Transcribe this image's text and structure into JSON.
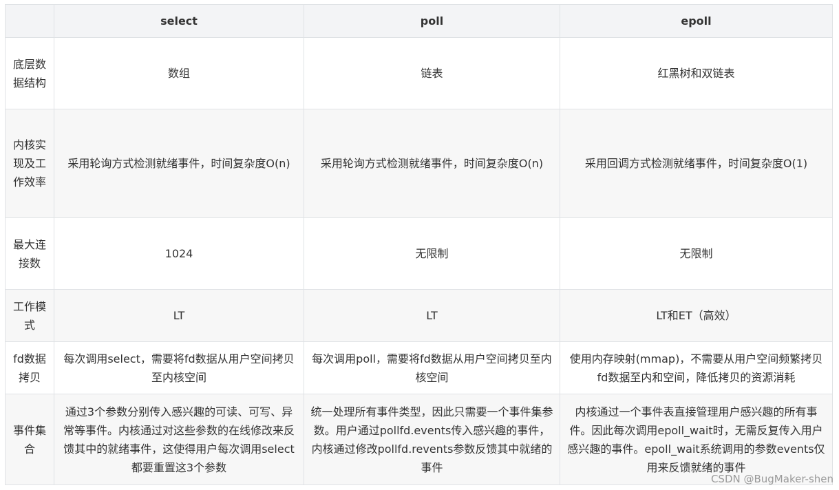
{
  "table": {
    "headers": [
      "",
      "select",
      "poll",
      "epoll"
    ],
    "rows": [
      {
        "label": "底层数据结构",
        "select": "数组",
        "poll": "链表",
        "epoll": "红黑树和双链表"
      },
      {
        "label": "内核实现及工作效率",
        "select": "采用轮询方式检测就绪事件，时间复杂度O(n)",
        "poll": "采用轮询方式检测就绪事件，时间复杂度O(n)",
        "epoll": "采用回调方式检测就绪事件，时间复杂度O(1)"
      },
      {
        "label": "最大连接数",
        "select": "1024",
        "poll": "无限制",
        "epoll": "无限制"
      },
      {
        "label": "工作模式",
        "select": "LT",
        "poll": "LT",
        "epoll": "LT和ET（高效）"
      },
      {
        "label": "fd数据拷贝",
        "select": "每次调用select，需要将fd数据从用户空间拷贝至内核空间",
        "poll": "每次调用poll，需要将fd数据从用户空间拷贝至内核空间",
        "epoll": "使用内存映射(mmap)，不需要从用户空间频繁拷贝fd数据至内和空间，降低拷贝的资源消耗"
      },
      {
        "label": "事件集合",
        "select": "通过3个参数分别传入感兴趣的可读、可写、异常等事件。内核通过对这些参数的在线修改来反馈其中的就绪事件，这使得用户每次调用select都要重置这3个参数",
        "poll": "统一处理所有事件类型，因此只需要一个事件集参数。用户通过pollfd.events传入感兴趣的事件，内核通过修改pollfd.revents参数反馈其中就绪的事件",
        "epoll": "内核通过一个事件表直接管理用户感兴趣的所有事件。因此每次调用epoll_wait时，无需反复传入用户感兴趣的事件。epoll_wait系统调用的参数events仅用来反馈就绪的事件"
      }
    ]
  },
  "watermark": "CSDN @BugMaker-shen"
}
